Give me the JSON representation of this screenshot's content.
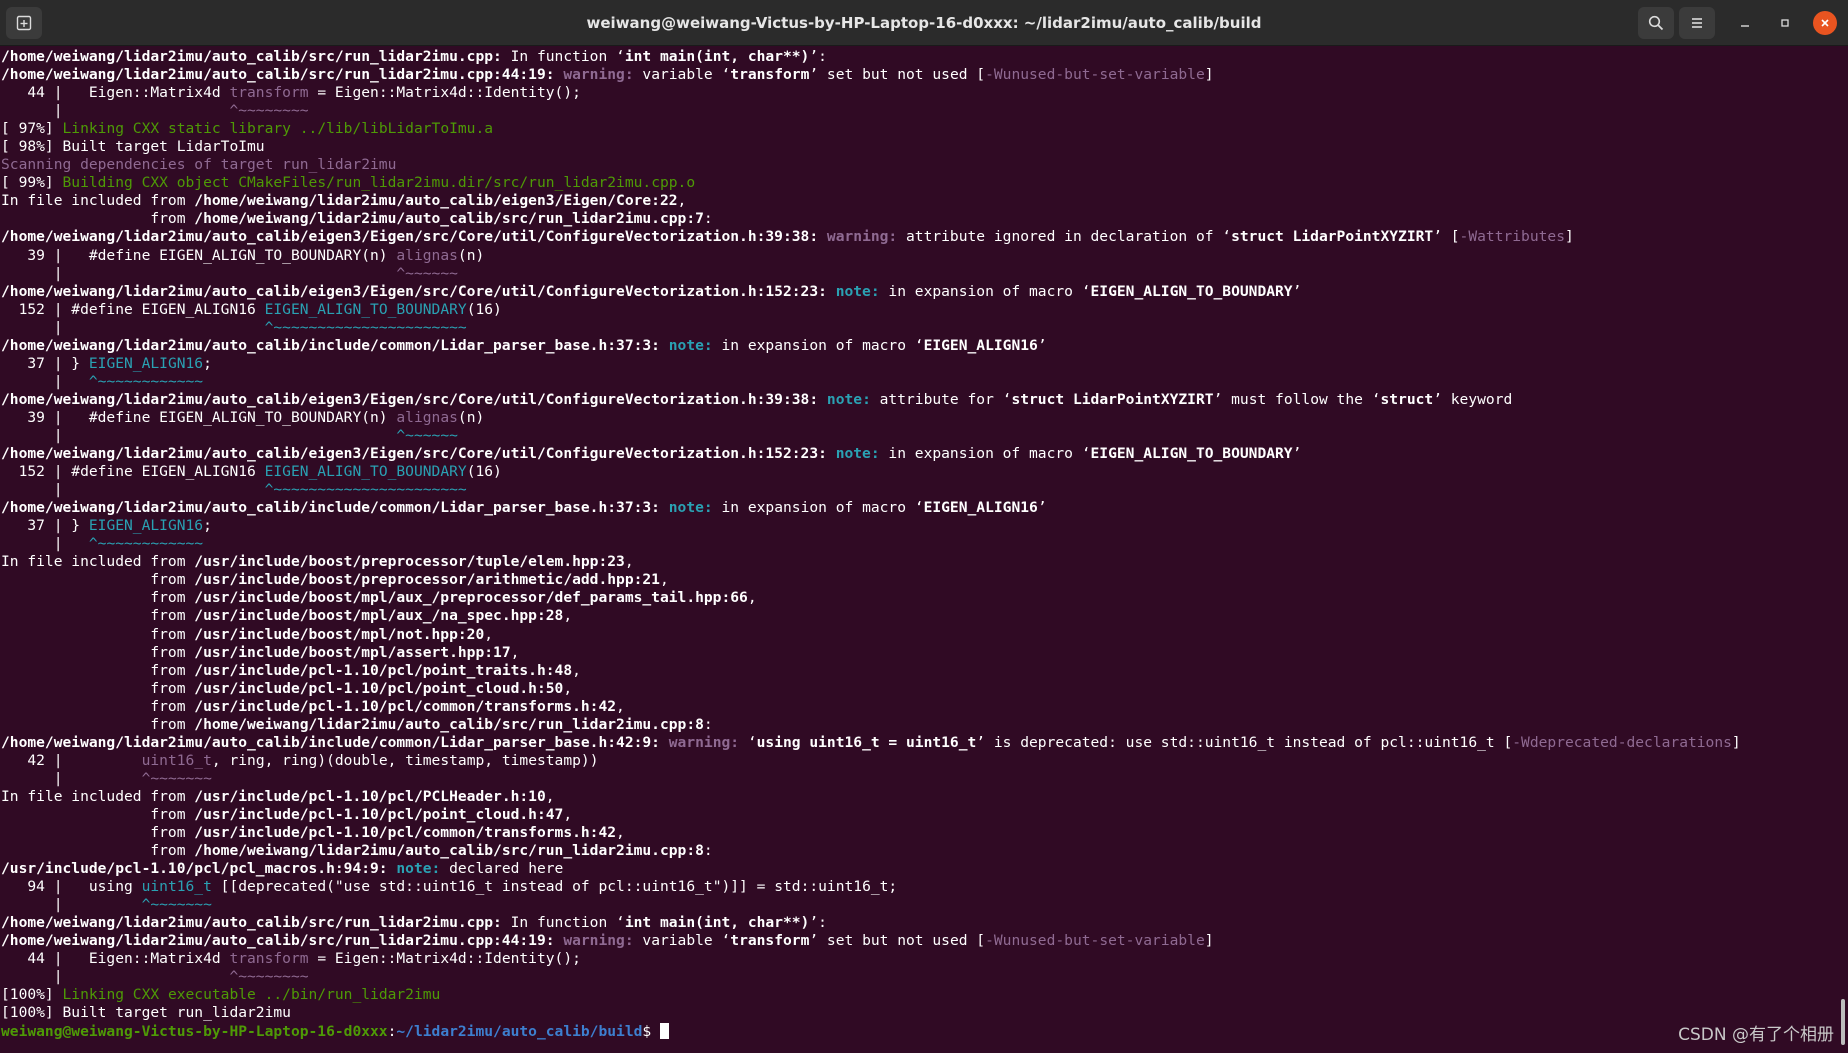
{
  "window": {
    "title": "weiwang@weiwang-Victus-by-HP-Laptop-16-d0xxx: ~/lidar2imu/auto_calib/build",
    "icons": [
      "new-tab-icon",
      "search-icon",
      "menu-icon",
      "minimize-icon",
      "maximize-icon",
      "close-icon"
    ]
  },
  "colors": {
    "background": "#300a24",
    "warning": "#8f6a92",
    "note": "#2aa1b3",
    "progress": "#4e9a06",
    "prompt_path": "#3d7fcf",
    "close_button": "#e95420"
  },
  "lines": [
    [
      [
        "/home/weiwang/lidar2imu/auto_calib/src/run_lidar2imu.cpp:",
        "b"
      ],
      [
        " In function ‘",
        ""
      ],
      [
        "int main(int, char**)",
        "b"
      ],
      [
        "’:",
        ""
      ]
    ],
    [
      [
        "/home/weiwang/lidar2imu/auto_calib/src/run_lidar2imu.cpp:44:19:",
        "b"
      ],
      [
        " ",
        ""
      ],
      [
        "warning:",
        "warn"
      ],
      [
        " variable ‘",
        ""
      ],
      [
        "transform",
        "b"
      ],
      [
        "’ set but not used [",
        ""
      ],
      [
        "-Wunused-but-set-variable",
        "mg"
      ],
      [
        "]",
        ""
      ]
    ],
    [
      [
        "   44 |   Eigen::Matrix4d ",
        ""
      ],
      [
        "transform",
        "mg"
      ],
      [
        " = Eigen::Matrix4d::Identity();",
        ""
      ]
    ],
    [
      [
        "      |                   ",
        ""
      ],
      [
        "^~~~~~~~~",
        "mg"
      ]
    ],
    [
      [
        "[ 97%] ",
        ""
      ],
      [
        "Linking CXX static library ../lib/libLidarToImu.a",
        "grn"
      ]
    ],
    [
      [
        "[ 98%] Built target LidarToImu",
        ""
      ]
    ],
    [
      [
        "Scanning dependencies of target run_lidar2imu",
        "mg"
      ]
    ],
    [
      [
        "[ 99%] ",
        ""
      ],
      [
        "Building CXX object CMakeFiles/run_lidar2imu.dir/src/run_lidar2imu.cpp.o",
        "grn"
      ]
    ],
    [
      [
        "In file included from ",
        ""
      ],
      [
        "/home/weiwang/lidar2imu/auto_calib/eigen3/Eigen/Core:22",
        "b"
      ],
      [
        ",",
        ""
      ]
    ],
    [
      [
        "                 from ",
        ""
      ],
      [
        "/home/weiwang/lidar2imu/auto_calib/src/run_lidar2imu.cpp:7",
        "b"
      ],
      [
        ":",
        ""
      ]
    ],
    [
      [
        "/home/weiwang/lidar2imu/auto_calib/eigen3/Eigen/src/Core/util/ConfigureVectorization.h:39:38:",
        "b"
      ],
      [
        " ",
        ""
      ],
      [
        "warning:",
        "warn"
      ],
      [
        " attribute ignored in declaration of ‘",
        ""
      ],
      [
        "struct LidarPointXYZIRT",
        "b"
      ],
      [
        "’ [",
        ""
      ],
      [
        "-Wattributes",
        "mg"
      ],
      [
        "]",
        ""
      ]
    ],
    [
      [
        "   39 |   #define EIGEN_ALIGN_TO_BOUNDARY(n) ",
        ""
      ],
      [
        "alignas",
        "mg"
      ],
      [
        "(n)",
        ""
      ]
    ],
    [
      [
        "      |                                      ",
        ""
      ],
      [
        "^~~~~~~",
        "mg"
      ]
    ],
    [
      [
        "/home/weiwang/lidar2imu/auto_calib/eigen3/Eigen/src/Core/util/ConfigureVectorization.h:152:23:",
        "b"
      ],
      [
        " ",
        ""
      ],
      [
        "note:",
        "note"
      ],
      [
        " in expansion of macro ‘",
        ""
      ],
      [
        "EIGEN_ALIGN_TO_BOUNDARY",
        "b"
      ],
      [
        "’",
        ""
      ]
    ],
    [
      [
        "  152 | #define EIGEN_ALIGN16 ",
        ""
      ],
      [
        "EIGEN_ALIGN_TO_BOUNDARY",
        "cy"
      ],
      [
        "(16)",
        ""
      ]
    ],
    [
      [
        "      |                       ",
        ""
      ],
      [
        "^~~~~~~~~~~~~~~~~~~~~~~",
        "cy"
      ]
    ],
    [
      [
        "/home/weiwang/lidar2imu/auto_calib/include/common/Lidar_parser_base.h:37:3:",
        "b"
      ],
      [
        " ",
        ""
      ],
      [
        "note:",
        "note"
      ],
      [
        " in expansion of macro ‘",
        ""
      ],
      [
        "EIGEN_ALIGN16",
        "b"
      ],
      [
        "’",
        ""
      ]
    ],
    [
      [
        "   37 | } ",
        ""
      ],
      [
        "EIGEN_ALIGN16",
        "cy"
      ],
      [
        ";",
        ""
      ]
    ],
    [
      [
        "      |   ",
        ""
      ],
      [
        "^~~~~~~~~~~~~",
        "cy"
      ]
    ],
    [
      [
        "/home/weiwang/lidar2imu/auto_calib/eigen3/Eigen/src/Core/util/ConfigureVectorization.h:39:38:",
        "b"
      ],
      [
        " ",
        ""
      ],
      [
        "note:",
        "note"
      ],
      [
        " attribute for ‘",
        ""
      ],
      [
        "struct LidarPointXYZIRT",
        "b"
      ],
      [
        "’ must follow the ‘",
        ""
      ],
      [
        "struct",
        "b"
      ],
      [
        "’ keyword",
        ""
      ]
    ],
    [
      [
        "   39 |   #define EIGEN_ALIGN_TO_BOUNDARY(n) ",
        ""
      ],
      [
        "alignas",
        "mg"
      ],
      [
        "(n)",
        ""
      ]
    ],
    [
      [
        "      |                                      ",
        ""
      ],
      [
        "^~~~~~~",
        "cy"
      ]
    ],
    [
      [
        "/home/weiwang/lidar2imu/auto_calib/eigen3/Eigen/src/Core/util/ConfigureVectorization.h:152:23:",
        "b"
      ],
      [
        " ",
        ""
      ],
      [
        "note:",
        "note"
      ],
      [
        " in expansion of macro ‘",
        ""
      ],
      [
        "EIGEN_ALIGN_TO_BOUNDARY",
        "b"
      ],
      [
        "’",
        ""
      ]
    ],
    [
      [
        "  152 | #define EIGEN_ALIGN16 ",
        ""
      ],
      [
        "EIGEN_ALIGN_TO_BOUNDARY",
        "cy"
      ],
      [
        "(16)",
        ""
      ]
    ],
    [
      [
        "      |                       ",
        ""
      ],
      [
        "^~~~~~~~~~~~~~~~~~~~~~~",
        "cy"
      ]
    ],
    [
      [
        "/home/weiwang/lidar2imu/auto_calib/include/common/Lidar_parser_base.h:37:3:",
        "b"
      ],
      [
        " ",
        ""
      ],
      [
        "note:",
        "note"
      ],
      [
        " in expansion of macro ‘",
        ""
      ],
      [
        "EIGEN_ALIGN16",
        "b"
      ],
      [
        "’",
        ""
      ]
    ],
    [
      [
        "   37 | } ",
        ""
      ],
      [
        "EIGEN_ALIGN16",
        "cy"
      ],
      [
        ";",
        ""
      ]
    ],
    [
      [
        "      |   ",
        ""
      ],
      [
        "^~~~~~~~~~~~~",
        "cy"
      ]
    ],
    [
      [
        "In file included from ",
        ""
      ],
      [
        "/usr/include/boost/preprocessor/tuple/elem.hpp:23",
        "b"
      ],
      [
        ",",
        ""
      ]
    ],
    [
      [
        "                 from ",
        ""
      ],
      [
        "/usr/include/boost/preprocessor/arithmetic/add.hpp:21",
        "b"
      ],
      [
        ",",
        ""
      ]
    ],
    [
      [
        "                 from ",
        ""
      ],
      [
        "/usr/include/boost/mpl/aux_/preprocessor/def_params_tail.hpp:66",
        "b"
      ],
      [
        ",",
        ""
      ]
    ],
    [
      [
        "                 from ",
        ""
      ],
      [
        "/usr/include/boost/mpl/aux_/na_spec.hpp:28",
        "b"
      ],
      [
        ",",
        ""
      ]
    ],
    [
      [
        "                 from ",
        ""
      ],
      [
        "/usr/include/boost/mpl/not.hpp:20",
        "b"
      ],
      [
        ",",
        ""
      ]
    ],
    [
      [
        "                 from ",
        ""
      ],
      [
        "/usr/include/boost/mpl/assert.hpp:17",
        "b"
      ],
      [
        ",",
        ""
      ]
    ],
    [
      [
        "                 from ",
        ""
      ],
      [
        "/usr/include/pcl-1.10/pcl/point_traits.h:48",
        "b"
      ],
      [
        ",",
        ""
      ]
    ],
    [
      [
        "                 from ",
        ""
      ],
      [
        "/usr/include/pcl-1.10/pcl/point_cloud.h:50",
        "b"
      ],
      [
        ",",
        ""
      ]
    ],
    [
      [
        "                 from ",
        ""
      ],
      [
        "/usr/include/pcl-1.10/pcl/common/transforms.h:42",
        "b"
      ],
      [
        ",",
        ""
      ]
    ],
    [
      [
        "                 from ",
        ""
      ],
      [
        "/home/weiwang/lidar2imu/auto_calib/src/run_lidar2imu.cpp:8",
        "b"
      ],
      [
        ":",
        ""
      ]
    ],
    [
      [
        "/home/weiwang/lidar2imu/auto_calib/include/common/Lidar_parser_base.h:42:9:",
        "b"
      ],
      [
        " ",
        ""
      ],
      [
        "warning:",
        "warn"
      ],
      [
        " ‘",
        ""
      ],
      [
        "using uint16_t = uint16_t",
        "b"
      ],
      [
        "’ is deprecated: use std::uint16_t instead of pcl::uint16_t [",
        ""
      ],
      [
        "-Wdeprecated-declarations",
        "mg"
      ],
      [
        "]",
        ""
      ]
    ],
    [
      [
        "   42 |         ",
        ""
      ],
      [
        "uint16_t",
        "mg"
      ],
      [
        ", ring, ring)(double, timestamp, timestamp))",
        ""
      ]
    ],
    [
      [
        "      |         ",
        ""
      ],
      [
        "^~~~~~~~",
        "mg"
      ]
    ],
    [
      [
        "In file included from ",
        ""
      ],
      [
        "/usr/include/pcl-1.10/pcl/PCLHeader.h:10",
        "b"
      ],
      [
        ",",
        ""
      ]
    ],
    [
      [
        "                 from ",
        ""
      ],
      [
        "/usr/include/pcl-1.10/pcl/point_cloud.h:47",
        "b"
      ],
      [
        ",",
        ""
      ]
    ],
    [
      [
        "                 from ",
        ""
      ],
      [
        "/usr/include/pcl-1.10/pcl/common/transforms.h:42",
        "b"
      ],
      [
        ",",
        ""
      ]
    ],
    [
      [
        "                 from ",
        ""
      ],
      [
        "/home/weiwang/lidar2imu/auto_calib/src/run_lidar2imu.cpp:8",
        "b"
      ],
      [
        ":",
        ""
      ]
    ],
    [
      [
        "/usr/include/pcl-1.10/pcl/pcl_macros.h:94:9:",
        "b"
      ],
      [
        " ",
        ""
      ],
      [
        "note:",
        "note"
      ],
      [
        " declared here",
        ""
      ]
    ],
    [
      [
        "   94 |   using ",
        ""
      ],
      [
        "uint16_t",
        "cy"
      ],
      [
        " [[deprecated(\"use std::uint16_t instead of pcl::uint16_t\")]] = std::uint16_t;",
        ""
      ]
    ],
    [
      [
        "      |         ",
        ""
      ],
      [
        "^~~~~~~~",
        "cy"
      ]
    ],
    [
      [
        "/home/weiwang/lidar2imu/auto_calib/src/run_lidar2imu.cpp:",
        "b"
      ],
      [
        " In function ‘",
        ""
      ],
      [
        "int main(int, char**)",
        "b"
      ],
      [
        "’:",
        ""
      ]
    ],
    [
      [
        "/home/weiwang/lidar2imu/auto_calib/src/run_lidar2imu.cpp:44:19:",
        "b"
      ],
      [
        " ",
        ""
      ],
      [
        "warning:",
        "warn"
      ],
      [
        " variable ‘",
        ""
      ],
      [
        "transform",
        "b"
      ],
      [
        "’ set but not used [",
        ""
      ],
      [
        "-Wunused-but-set-variable",
        "mg"
      ],
      [
        "]",
        ""
      ]
    ],
    [
      [
        "   44 |   Eigen::Matrix4d ",
        ""
      ],
      [
        "transform",
        "mg"
      ],
      [
        " = Eigen::Matrix4d::Identity();",
        ""
      ]
    ],
    [
      [
        "      |                   ",
        ""
      ],
      [
        "^~~~~~~~~",
        "mg"
      ]
    ],
    [
      [
        "[100%] ",
        ""
      ],
      [
        "Linking CXX executable ../bin/run_lidar2imu",
        "grn"
      ]
    ],
    [
      [
        "[100%] Built target run_lidar2imu",
        ""
      ]
    ]
  ],
  "prompt": {
    "user": "weiwang@weiwang-Victus-by-HP-Laptop-16-d0xxx",
    "sep": ":",
    "path": "~/lidar2imu/auto_calib/build",
    "symbol": "$ "
  },
  "watermark": "CSDN @有了个相册"
}
